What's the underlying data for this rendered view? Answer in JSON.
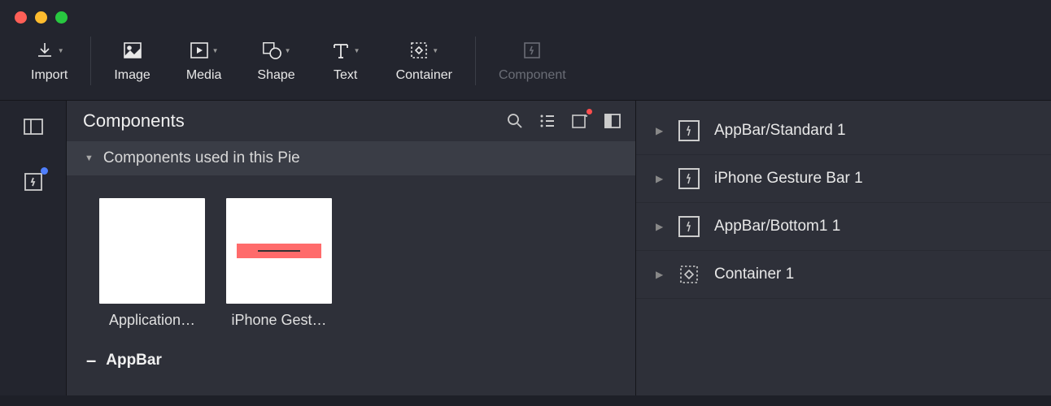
{
  "toolbar": {
    "import": "Import",
    "image": "Image",
    "media": "Media",
    "shape": "Shape",
    "text": "Text",
    "container": "Container",
    "component": "Component"
  },
  "panel": {
    "title": "Components",
    "section_used": "Components used in this Pie",
    "section_appbar": "AppBar"
  },
  "thumbs": [
    {
      "label": "Application…"
    },
    {
      "label": "iPhone Gest…"
    }
  ],
  "layers": [
    {
      "type": "component",
      "name": "AppBar/Standard 1"
    },
    {
      "type": "component",
      "name": "iPhone Gesture Bar 1"
    },
    {
      "type": "component",
      "name": "AppBar/Bottom1 1"
    },
    {
      "type": "container",
      "name": "Container 1"
    }
  ]
}
